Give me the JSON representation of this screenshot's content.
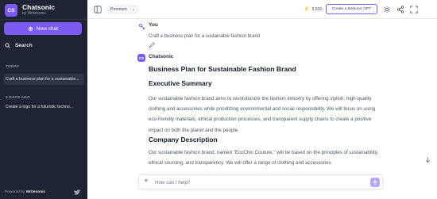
{
  "sidebar": {
    "logo_text": "CS",
    "app_name": "Chatsonic",
    "app_sub": "by Writesonic",
    "new_chat_label": "New chat",
    "search_label": "Search",
    "sections": [
      {
        "label": "TODAY",
        "items": [
          "Craft a business plan for a sustainable..."
        ]
      },
      {
        "label": "2 DAYS AGO",
        "items": [
          "Create a logo for a futuristic techno..."
        ]
      }
    ],
    "powered_prefix": "Powered by",
    "powered_brand": "Writesonic"
  },
  "topbar": {
    "tier_label": "Premium",
    "credits": "9,800",
    "create_bot_label": "Create a Botsonic GPT"
  },
  "chat": {
    "user_name": "You",
    "user_message": "Craft a business plan for a sustainable fashion brand",
    "bot_avatar": "CS",
    "bot_name": "Chatsonic",
    "response_title": "Business Plan for Sustainable Fashion Brand",
    "sections": [
      {
        "heading": "Executive Summary",
        "body": "Our sustainable fashion brand aims to revolutionize the fashion industry by offering stylish, high-quality clothing and accessories while prioritizing environmental and social responsibility. We will focus on using eco-friendly materials, ethical production processes, and transparent supply chains to create a positive impact on both the planet and the people."
      },
      {
        "heading": "Company Description",
        "body": "Our sustainable fashion brand, named \"EcoChic Couture,\" will be based on the principles of sustainability, ethical sourcing, and transparency. We will offer a range of clothing and accessories"
      }
    ]
  },
  "input": {
    "placeholder": "How can I help?"
  },
  "colors": {
    "accent": "#7c5cf0",
    "sidebar_bg": "#1e2433"
  }
}
